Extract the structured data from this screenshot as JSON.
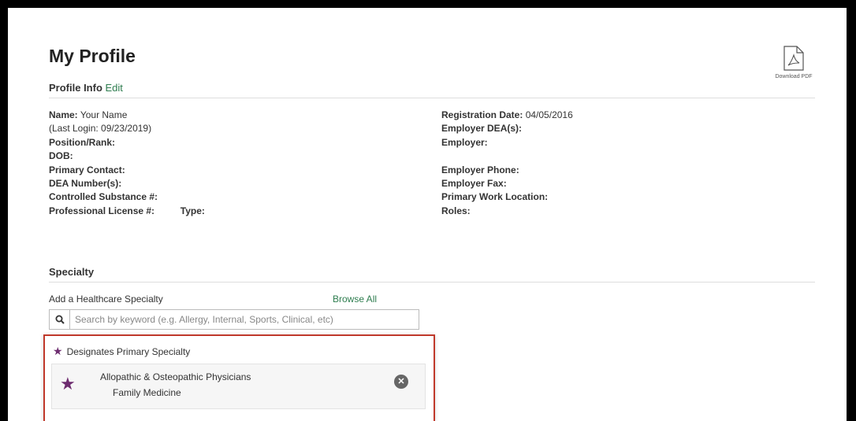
{
  "page": {
    "title": "My Profile"
  },
  "download_pdf": {
    "label": "Download PDF"
  },
  "profile_info": {
    "heading": "Profile Info",
    "edit_label": "Edit",
    "left": {
      "name_label": "Name:",
      "name_value": "Your Name",
      "last_login": "(Last Login: 09/23/2019)",
      "position_label": "Position/Rank:",
      "dob_label": "DOB:",
      "primary_contact_label": "Primary Contact:",
      "dea_label": "DEA Number(s):",
      "controlled_label": "Controlled Substance #:",
      "license_label": "Professional License #:",
      "type_label": "Type:"
    },
    "right": {
      "registration_label": "Registration Date:",
      "registration_value": "04/05/2016",
      "employer_dea_label": "Employer DEA(s):",
      "employer_label": "Employer:",
      "employer_phone_label": "Employer Phone:",
      "employer_fax_label": "Employer Fax:",
      "work_location_label": "Primary Work Location:",
      "roles_label": "Roles:"
    }
  },
  "specialty": {
    "heading": "Specialty",
    "add_label": "Add a Healthcare Specialty",
    "browse_label": "Browse All",
    "search_placeholder": "Search by keyword (e.g. Allergy, Internal, Sports, Clinical, etc)",
    "legend": "Designates Primary Specialty",
    "items": [
      {
        "category": "Allopathic & Osteopathic Physicians",
        "name": "Family Medicine"
      }
    ]
  },
  "colors": {
    "accent_green": "#2e7d4f",
    "primary_star": "#6d2c6f",
    "highlight_border": "#c0392b"
  },
  "icons": {
    "download": "pdf-file-icon",
    "search": "search-icon",
    "primary": "star-icon",
    "remove": "close-icon"
  }
}
